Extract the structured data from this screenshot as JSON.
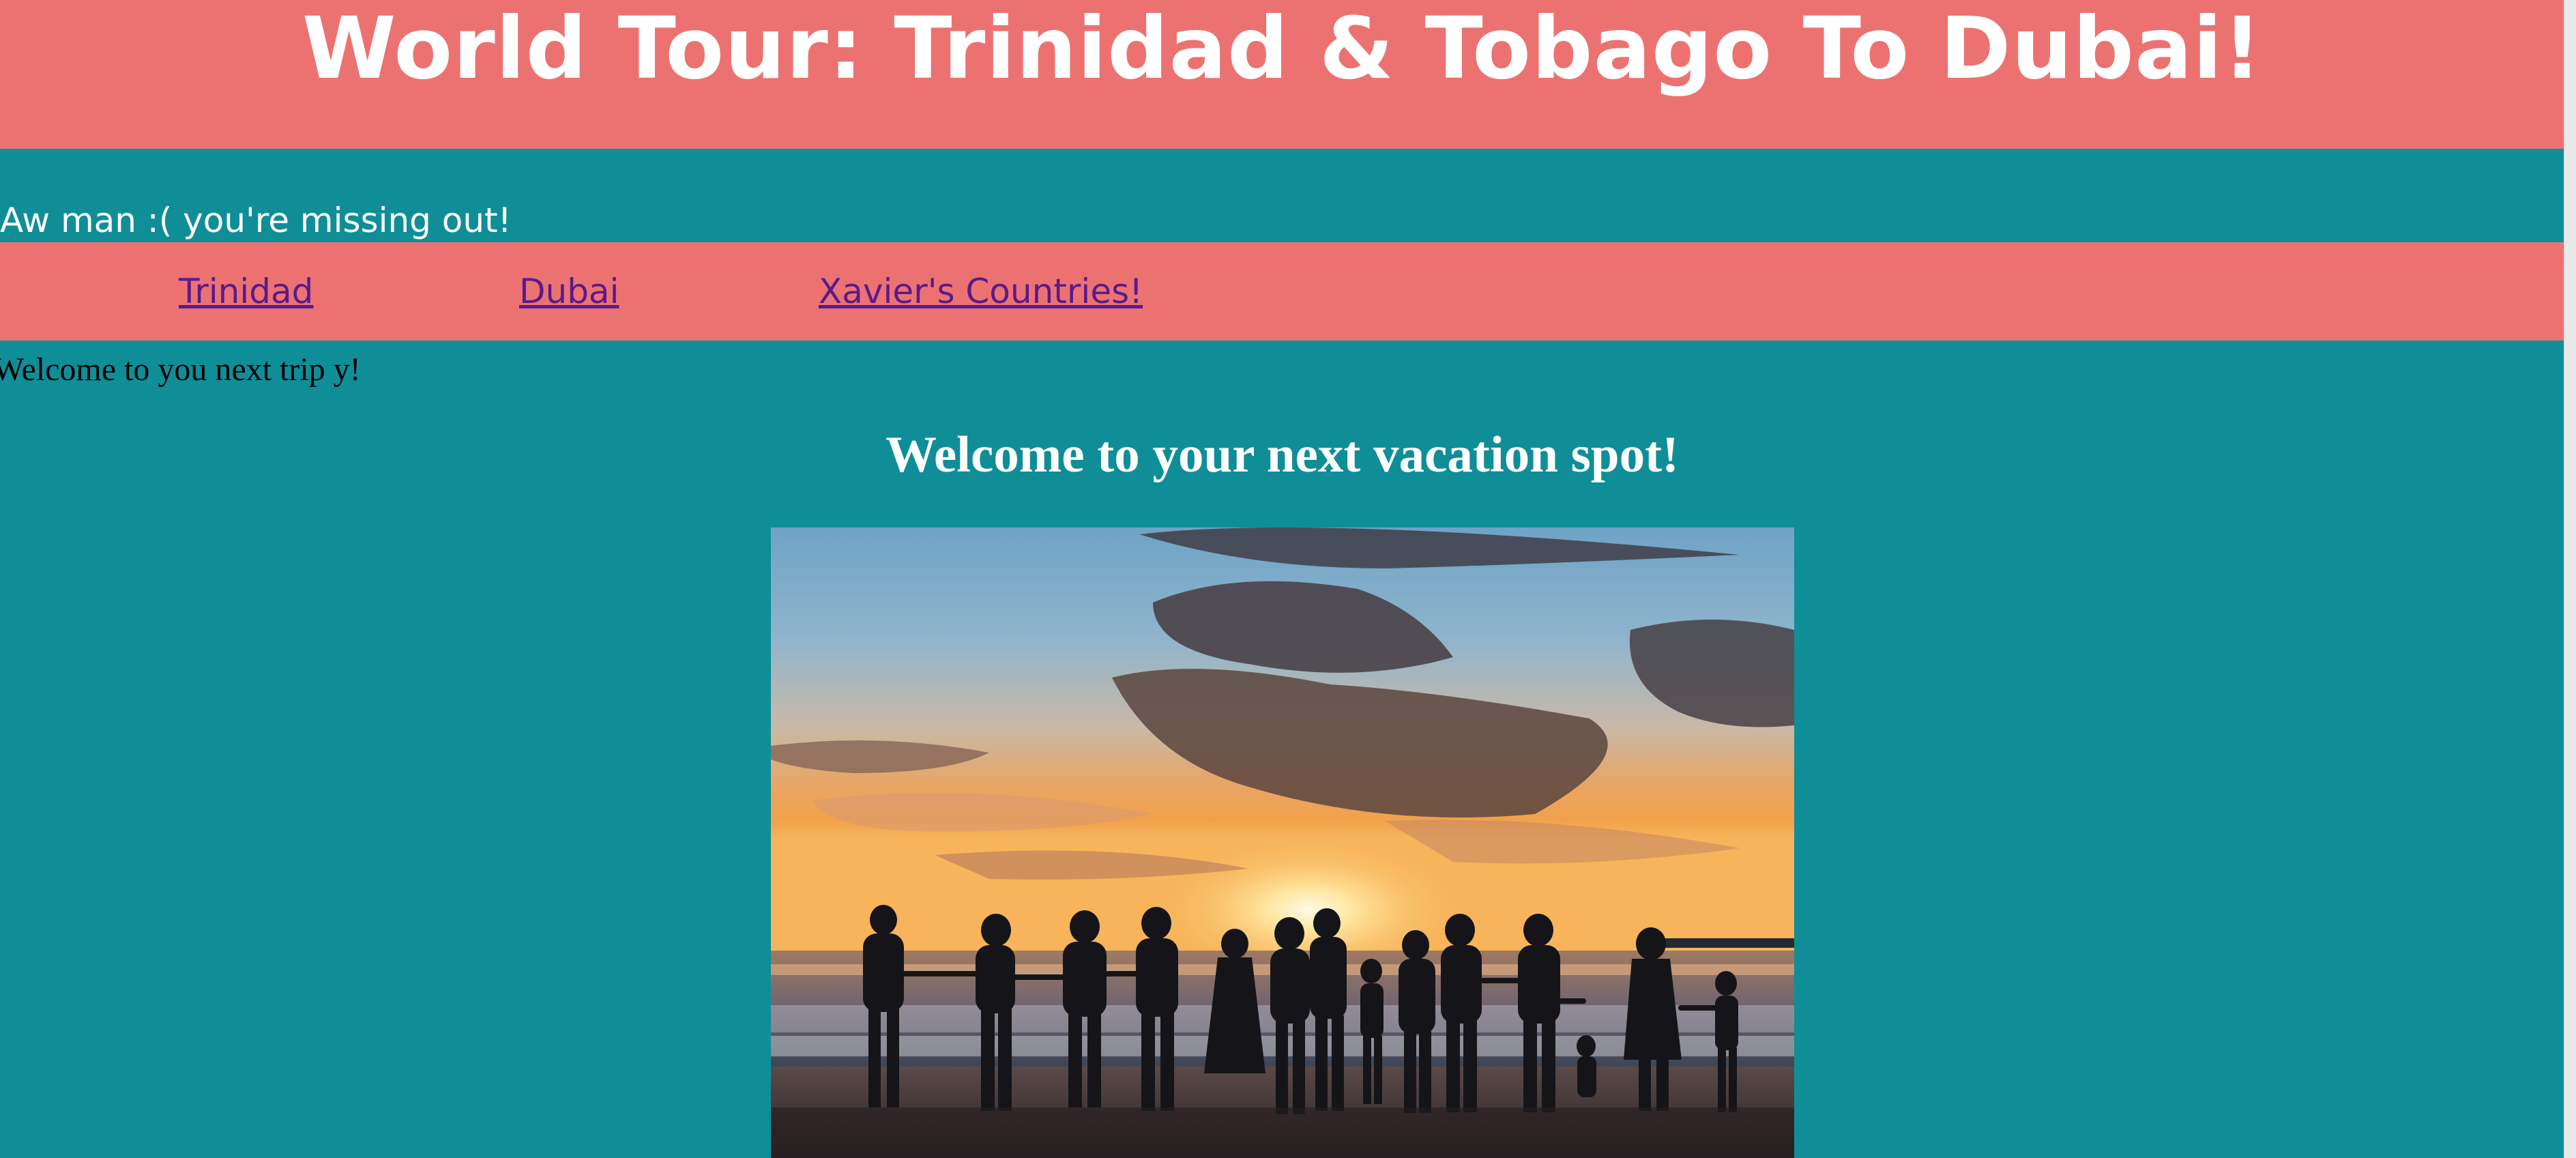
{
  "header": {
    "title": "World Tour: Trinidad & Tobago To Dubai!"
  },
  "intro": {
    "missing_text": "Aw man :( you're missing out!"
  },
  "nav": {
    "links": [
      {
        "label": "Trinidad"
      },
      {
        "label": "Dubai"
      },
      {
        "label": "Xavier's Countries!"
      }
    ]
  },
  "main": {
    "welcome_line": "Welcome to you next trip y!",
    "heading": "Welcome to your next vacation spot!",
    "image": {
      "subject": "family-silhouette-sunset-beach"
    }
  },
  "colors": {
    "background": "#0f8e98",
    "banner": "#ec7272",
    "link": "#5a1a8c",
    "heading_text": "#ffffff"
  }
}
